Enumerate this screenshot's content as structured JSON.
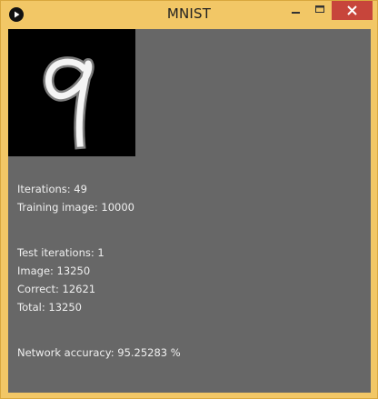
{
  "window": {
    "title": "MNIST",
    "icons": {
      "app": "play-icon",
      "minimize": "minimize-icon",
      "maximize": "maximize-icon",
      "close": "close-icon"
    },
    "colors": {
      "frame": "#f2c766",
      "close_button": "#c7453b",
      "client_background": "#676767",
      "text": "#efefef",
      "digit_background": "#000000"
    }
  },
  "digit_preview": {
    "icon": "handwritten-digit-9-image"
  },
  "stats": {
    "iterations": "Iterations: 49",
    "training_image": "Training image: 10000",
    "test_iterations": "Test iterations: 1",
    "image": "Image: 13250",
    "correct": "Correct: 12621",
    "total": "Total: 13250",
    "network_accuracy": "Network accuracy: 95.25283 %"
  }
}
